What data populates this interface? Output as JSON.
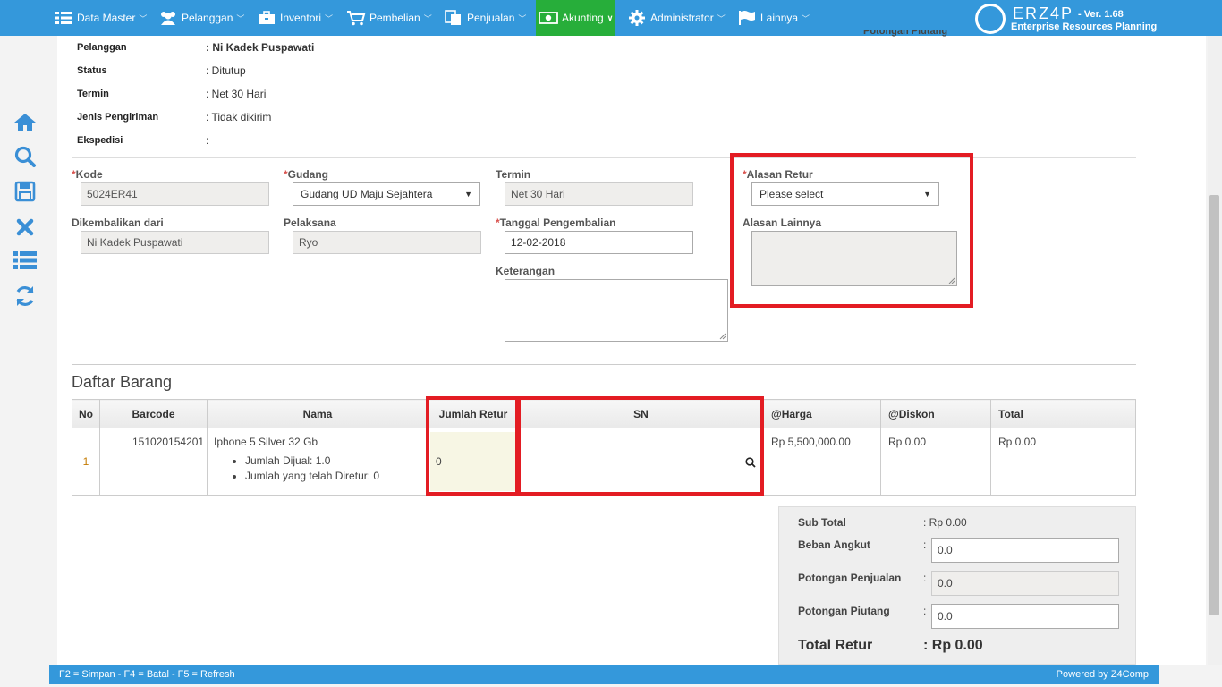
{
  "nav": {
    "items": [
      {
        "label": "Data Master",
        "icon": "grid-list-icon"
      },
      {
        "label": "Pelanggan",
        "icon": "users-icon"
      },
      {
        "label": "Inventori",
        "icon": "briefcase-icon"
      },
      {
        "label": "Pembelian",
        "icon": "cart-icon"
      },
      {
        "label": "Penjualan",
        "icon": "documents-icon"
      },
      {
        "label": "Akunting",
        "icon": "money-icon"
      },
      {
        "label": "Administrator",
        "icon": "gear-icon"
      },
      {
        "label": "Lainnya",
        "icon": "flag-icon"
      }
    ],
    "active": "Akunting",
    "brand": {
      "name": "ERZ4P",
      "version": "- Ver. 1.68",
      "tagline": "Enterprise Resources Planning"
    },
    "colors": {
      "bar": "#3498db",
      "active": "#27ae3a"
    }
  },
  "cropped_header_text": "Potongan Piutang",
  "info": {
    "pelanggan_label": "Pelanggan",
    "pelanggan_value": ": Ni Kadek Puspawati",
    "status_label": "Status",
    "status_value": ": Ditutup",
    "termin_label": "Termin",
    "termin_value": ": Net 30 Hari",
    "jenis_label": "Jenis Pengiriman",
    "jenis_value": ": Tidak dikirim",
    "ekspedisi_label": "Ekspedisi",
    "ekspedisi_value": ":"
  },
  "form": {
    "kode_label": "Kode",
    "kode_value": "5024ER41",
    "gudang_label": "Gudang",
    "gudang_value": "Gudang UD Maju Sejahtera",
    "termin_label": "Termin",
    "termin_value": "Net 30 Hari",
    "alasan_label": "Alasan Retur",
    "alasan_value": "Please select",
    "dikembalikan_label": "Dikembalikan dari",
    "dikembalikan_value": "Ni Kadek Puspawati",
    "pelaksana_label": "Pelaksana",
    "pelaksana_value": "Ryo",
    "tanggal_label": "Tanggal Pengembalian",
    "tanggal_value": "12-02-2018",
    "alasan_lainnya_label": "Alasan Lainnya",
    "keterangan_label": "Keterangan",
    "required_mark": "*"
  },
  "table": {
    "title": "Daftar Barang",
    "headers": [
      "No",
      "Barcode",
      "Nama",
      "Jumlah Retur",
      "SN",
      "@Harga",
      "@Diskon",
      "Total"
    ],
    "rows": [
      {
        "no": "1",
        "barcode": "151020154201",
        "nama": "Iphone 5 Silver 32 Gb",
        "details": [
          "Jumlah Dijual: 1.0",
          "Jumlah yang telah Diretur: 0"
        ],
        "jumlah_retur": "0",
        "sn": "",
        "harga": "Rp 5,500,000.00",
        "diskon": "Rp 0.00",
        "total": "Rp 0.00"
      }
    ]
  },
  "totals": {
    "sub_total_label": "Sub Total",
    "sub_total_value": ": Rp 0.00",
    "beban_label": "Beban Angkut",
    "beban_value": "0.0",
    "potongan_penjualan_label": "Potongan Penjualan",
    "potongan_penjualan_value": "0.0",
    "potongan_piutang_label": "Potongan Piutang",
    "potongan_piutang_value": "0.0",
    "colon": ":",
    "total_label": "Total Retur",
    "total_value": ": Rp 0.00"
  },
  "footer": {
    "shortcuts": "F2 = Simpan - F4 = Batal - F5 = Refresh",
    "powered": "Powered by Z4Comp"
  },
  "highlight_color": "#e31c23"
}
